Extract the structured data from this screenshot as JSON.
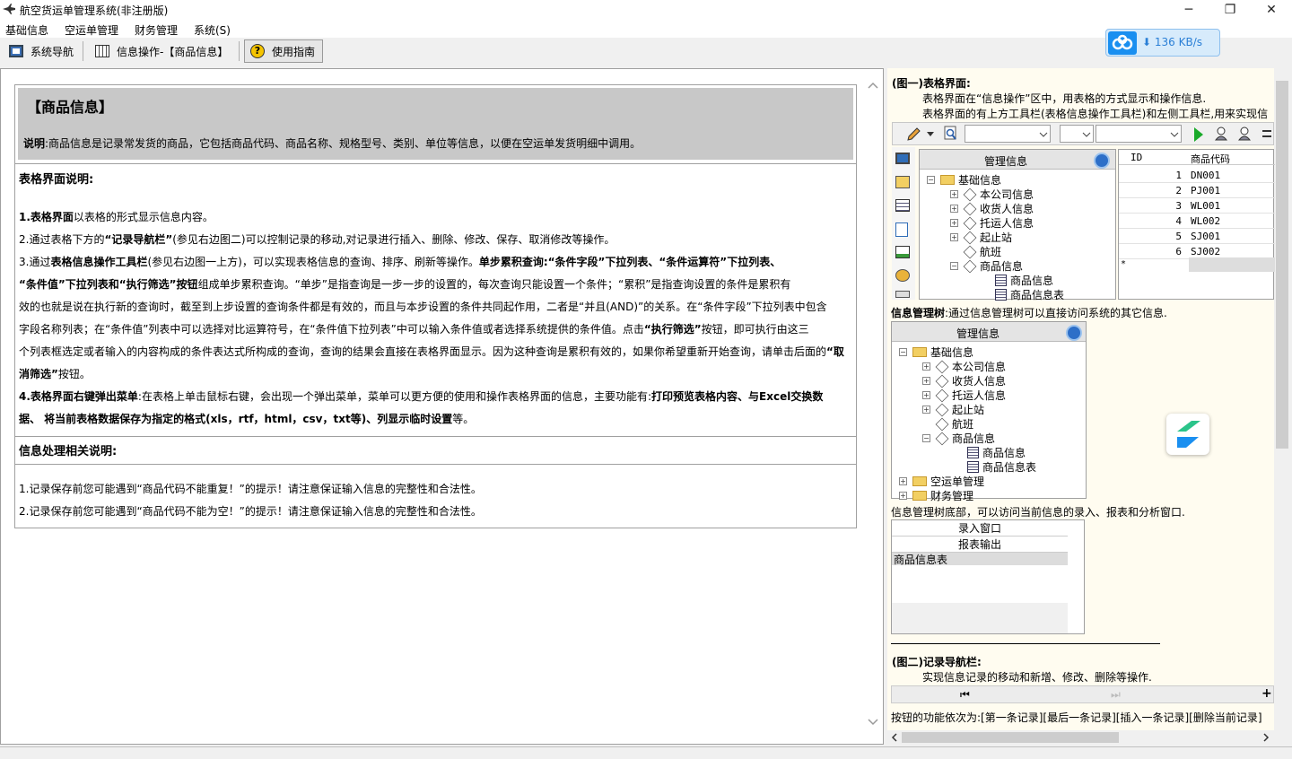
{
  "window": {
    "title": "航空货运单管理系统(非注册版)",
    "minimize_glyph": "─",
    "maximize_glyph": "❐",
    "close_glyph": "✕"
  },
  "menu": [
    "基础信息",
    "空运单管理",
    "财务管理",
    "系统(S)"
  ],
  "tabs": [
    {
      "label": "系统导航",
      "icon": "monitor-icon"
    },
    {
      "label": "信息操作-【商品信息】",
      "icon": "table-icon"
    },
    {
      "label": "使用指南",
      "icon": "help-icon",
      "active": true
    }
  ],
  "network": {
    "speed": "136 KB/s",
    "arrow": "⬇"
  },
  "doc": {
    "title": "【商品信息】",
    "desc_label": "说明",
    "desc_text": ":商品信息是记录常发货的商品，它包括商品代码、商品名称、规格型号、类别、单位等信息，以便在空运单发货明细中调用。",
    "section1_head": "表格界面说明:",
    "item1_bold": "1.表格界面",
    "item1_text": "以表格的形式显示信息内容。",
    "item2_a": "2.通过表格下方的",
    "item2_b": "“记录导航栏”",
    "item2_c": "(参见右边图二)可以控制记录的移动,对记录进行插入、删除、修改、保存、取消修改等操作。",
    "item3_a": "3.通过",
    "item3_b": "表格信息操作工具栏",
    "item3_c": "(参见右边图一上方)，可以实现表格信息的查询、排序、刷新等操作。",
    "item3_d": "单步累积查询:“条件字段”下拉列表、“条件运算符”下拉列表、",
    "item3_line2_b": "“条件值”下拉列表和“执行筛选”按钮",
    "item3_line2_c": "组成单步累积查询。“单步”是指查询是一步一步的设置的，每次查询只能设置一个条件；“累积”是指查询设置的条件是累积有",
    "item3_line3": "效的也就是说在执行新的查询时，截至到上步设置的查询条件都是有效的，而且与本步设置的条件共同起作用，二者是“并且(AND)”的关系。在“条件字段”下拉列表中包含",
    "item3_line4": "字段名称列表；在“条件值”列表中可以选择对比运算符号，在“条件值下拉列表”中可以输入条件值或者选择系统提供的条件值。点击",
    "item3_line4_b": "“执行筛选”",
    "item3_line4_c": "按钮，即可执行由这三",
    "item3_line5": "个列表框选定或者输入的内容构成的条件表达式所构成的查询，查询的结果会直接在表格界面显示。因为这种查询是累积有效的，如果你希望重新开始查询，请单击后面的",
    "item3_line5_b": "“取",
    "item3_line6_b": "消筛选”",
    "item3_line6_c": "按钮。",
    "item4_bold": "4.表格界面右键弹出菜单",
    "item4_text": ":在表格上单击鼠标右键，会出现一个弹出菜单，菜单可以更方便的使用和操作表格界面的信息，主要功能有:",
    "item4_b2": "打印预览表格内容、与Excel交换数",
    "item4_line2": "据、 将当前表格数据保存为指定的格式(xls，rtf，html，csv，txt等)、列显示临时设置",
    "item4_line2_c": "等。",
    "section2_head": "信息处理相关说明:",
    "note1": "1.记录保存前您可能遇到“商品代码不能重复！”的提示！请注意保证输入信息的完整性和合法性。",
    "note2": "2.记录保存前您可能遇到“商品代码不能为空！”的提示！请注意保证输入信息的完整性和合法性。"
  },
  "right": {
    "fig1_title": "(图一)表格界面:",
    "fig1_line1": "表格界面在“信息操作”区中，用表格的方式显示和操作信息.",
    "fig1_line2": "表格界面的有上方工具栏(表格信息操作工具栏)和左侧工具栏,用来实现信",
    "tree_header": "管理信息",
    "tree_root": "基础信息",
    "tree_items": [
      "本公司信息",
      "收货人信息",
      "托运人信息",
      "起止站",
      "航班",
      "商品信息"
    ],
    "tree_sub": [
      "商品信息",
      "商品信息表"
    ],
    "tree_extra": [
      "空运单管理",
      "财务管理"
    ],
    "grid_headers": [
      "ID",
      "商品代码"
    ],
    "grid_rows": [
      {
        "id": "1",
        "code": "DN001"
      },
      {
        "id": "2",
        "code": "PJ001"
      },
      {
        "id": "3",
        "code": "WL001"
      },
      {
        "id": "4",
        "code": "WL002"
      },
      {
        "id": "5",
        "code": "SJ001"
      },
      {
        "id": "6",
        "code": "SJ002"
      }
    ],
    "grid_new_marker": "*",
    "tree_caption_bold": "信息管理树",
    "tree_caption": ":通过信息管理树可以直接访问系统的其它信息.",
    "bottom_caption": "信息管理树底部，可以访问当前信息的录入、报表和分析窗口.",
    "panel_items": [
      "录入窗口",
      "报表输出",
      "商品信息表"
    ],
    "fig2_title": "(图二)记录导航栏:",
    "fig2_line": "实现信息记录的移动和新增、修改、删除等操作.",
    "nav_first": "⏮",
    "nav_last": "⏭",
    "nav_add": "+",
    "buttons_line": "按钮的功能依次为:[第一条记录][最后一条记录][插入一条记录][删除当前记录]"
  },
  "colors": {
    "accent": "#1a8ff0",
    "panel": "#fffcf0",
    "doc_header": "#c8c8c8"
  }
}
